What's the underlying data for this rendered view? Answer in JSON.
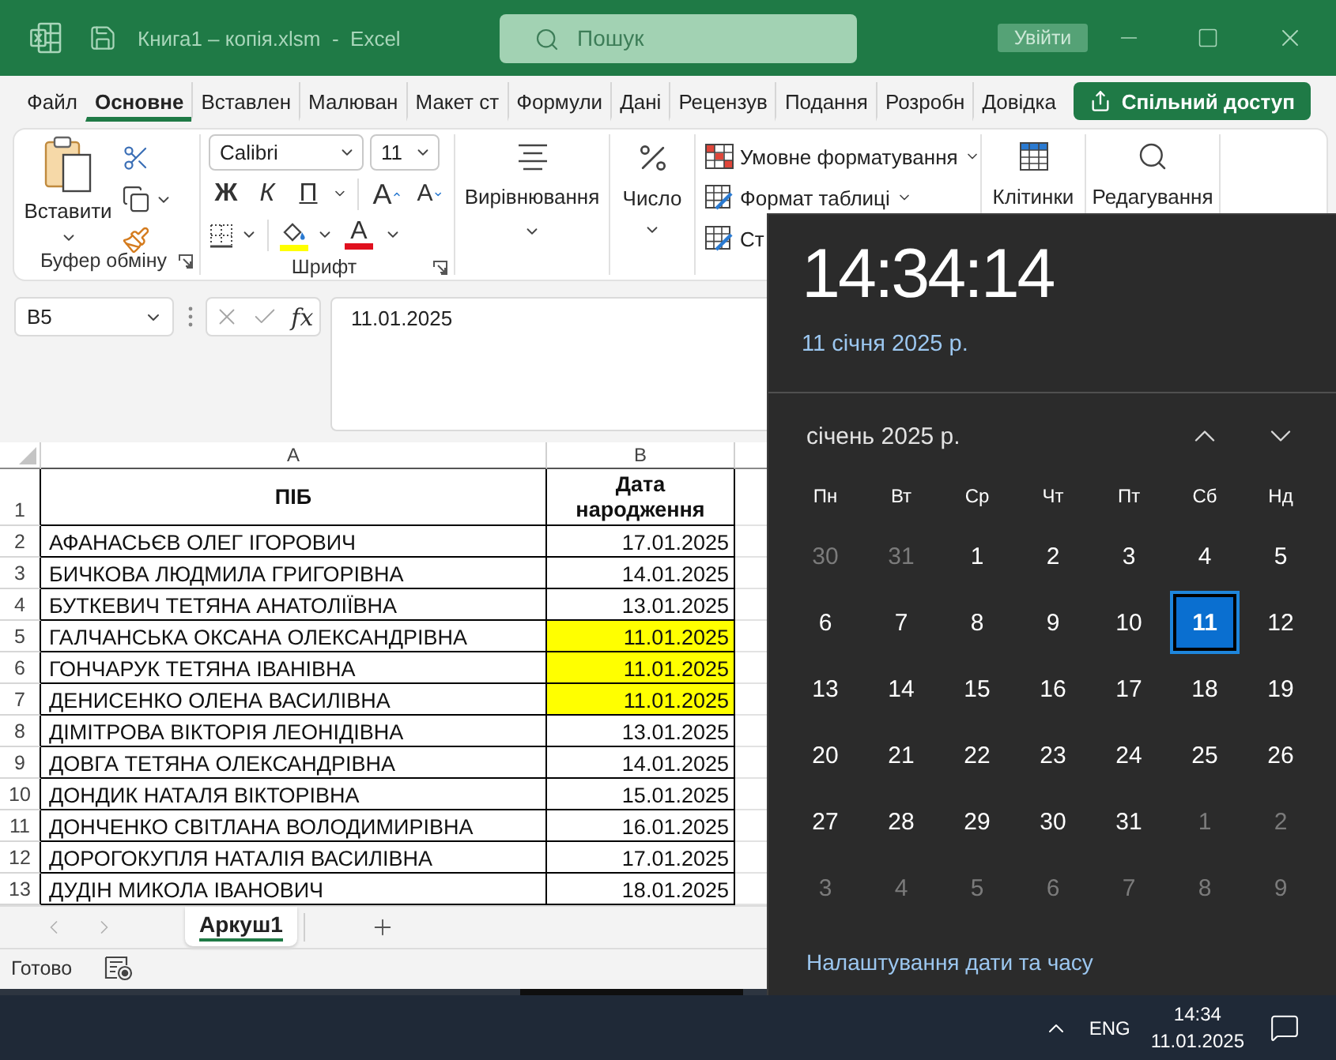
{
  "title_bar": {
    "document_title": "Книга1 – копія.xlsm  -  Excel",
    "search": {
      "placeholder": "Пошук"
    },
    "sign_in_button": "Увійти"
  },
  "ribbon_tabs": [
    {
      "label": "Файл",
      "selected": false
    },
    {
      "label": "Основне",
      "selected": true
    },
    {
      "label": "Вставлен",
      "selected": false
    },
    {
      "label": "Малюван",
      "selected": false
    },
    {
      "label": "Макет ст",
      "selected": false
    },
    {
      "label": "Формули",
      "selected": false
    },
    {
      "label": "Дані",
      "selected": false
    },
    {
      "label": "Рецензув",
      "selected": false
    },
    {
      "label": "Подання",
      "selected": false
    },
    {
      "label": "Розробн",
      "selected": false
    },
    {
      "label": "Довідка",
      "selected": false
    }
  ],
  "share_button": "Спільний доступ",
  "ribbon": {
    "clipboard": {
      "paste_button": "Вставити",
      "group_label": "Буфер обміну"
    },
    "font": {
      "font_name": "Calibri",
      "font_size": "11",
      "bold_button": "Ж",
      "italic_button": "К",
      "underline_button": "П",
      "grow_button": "A",
      "shrink_button": "A",
      "font_color_button": "A",
      "group_label": "Шрифт"
    },
    "alignment_button": "Вирівнювання",
    "number_button": "Число",
    "styles_buttons": [
      {
        "kind": "conditional",
        "label": "Умовне форматування",
        "dropdown": true
      },
      {
        "kind": "table",
        "label": "Формат таблиці",
        "dropdown": true
      },
      {
        "kind": "cell_styles",
        "label": "Ст"
      }
    ],
    "cells_button": "Клітинки",
    "editing_button": "Редагування"
  },
  "formula_bar": {
    "name_box": "B5",
    "function_button": "fx",
    "value": "11.01.2025"
  },
  "sheet": {
    "columns": [
      "A",
      "B"
    ],
    "header_row": {
      "number": "1",
      "name": "ПІБ",
      "date": "Дата народження"
    },
    "rows": [
      {
        "number": "2",
        "name": "АФАНАСЬЄВ ОЛЕГ ІГОРОВИЧ",
        "date": "17.01.2025",
        "highlighted": false
      },
      {
        "number": "3",
        "name": "БИЧКОВА ЛЮДМИЛА ГРИГОРІВНА",
        "date": "14.01.2025",
        "highlighted": false
      },
      {
        "number": "4",
        "name": "БУТКЕВИЧ ТЕТЯНА АНАТОЛІЇВНА",
        "date": "13.01.2025",
        "highlighted": false
      },
      {
        "number": "5",
        "name": "ГАЛЧАНСЬКА ОКСАНА ОЛЕКСАНДРІВНА",
        "date": "11.01.2025",
        "highlighted": true
      },
      {
        "number": "6",
        "name": "ГОНЧАРУК ТЕТЯНА ІВАНІВНА",
        "date": "11.01.2025",
        "highlighted": true
      },
      {
        "number": "7",
        "name": "ДЕНИСЕНКО ОЛЕНА ВАСИЛІВНА",
        "date": "11.01.2025",
        "highlighted": true
      },
      {
        "number": "8",
        "name": "ДІМІТРОВА ВІКТОРІЯ ЛЕОНІДІВНА",
        "date": "13.01.2025",
        "highlighted": false
      },
      {
        "number": "9",
        "name": "ДОВГА ТЕТЯНА ОЛЕКСАНДРІВНА",
        "date": "14.01.2025",
        "highlighted": false
      },
      {
        "number": "10",
        "name": "ДОНДИК НАТАЛЯ ВІКТОРІВНА",
        "date": "15.01.2025",
        "highlighted": false
      },
      {
        "number": "11",
        "name": "ДОНЧЕНКО СВІТЛАНА ВОЛОДИМИРІВНА",
        "date": "16.01.2025",
        "highlighted": false
      },
      {
        "number": "12",
        "name": "ДОРОГОКУПЛЯ НАТАЛІЯ ВАСИЛІВНА",
        "date": "17.01.2025",
        "highlighted": false
      },
      {
        "number": "13",
        "name": "ДУДІН МИКОЛА ІВАНОВИЧ",
        "date": "18.01.2025",
        "highlighted": false
      }
    ]
  },
  "sheet_tabs": [
    {
      "label": "Аркуш1",
      "selected": true
    }
  ],
  "status_bar": {
    "status": "Готово"
  },
  "taskbar": {
    "language": "ENG",
    "time": "14:34",
    "date": "11.01.2025"
  },
  "calendar": {
    "time": "14:34:14",
    "date": "11 січня 2025 р.",
    "month": "січень 2025 р.",
    "weekdays": [
      "Пн",
      "Вт",
      "Ср",
      "Чт",
      "Пт",
      "Сб",
      "Нд"
    ],
    "days": [
      {
        "label": "30",
        "in_month": false,
        "selected": false
      },
      {
        "label": "31",
        "in_month": false,
        "selected": false
      },
      {
        "label": "1",
        "in_month": true,
        "selected": false
      },
      {
        "label": "2",
        "in_month": true,
        "selected": false
      },
      {
        "label": "3",
        "in_month": true,
        "selected": false
      },
      {
        "label": "4",
        "in_month": true,
        "selected": false
      },
      {
        "label": "5",
        "in_month": true,
        "selected": false
      },
      {
        "label": "6",
        "in_month": true,
        "selected": false
      },
      {
        "label": "7",
        "in_month": true,
        "selected": false
      },
      {
        "label": "8",
        "in_month": true,
        "selected": false
      },
      {
        "label": "9",
        "in_month": true,
        "selected": false
      },
      {
        "label": "10",
        "in_month": true,
        "selected": false
      },
      {
        "label": "11",
        "in_month": true,
        "selected": true
      },
      {
        "label": "12",
        "in_month": true,
        "selected": false
      },
      {
        "label": "13",
        "in_month": true,
        "selected": false
      },
      {
        "label": "14",
        "in_month": true,
        "selected": false
      },
      {
        "label": "15",
        "in_month": true,
        "selected": false
      },
      {
        "label": "16",
        "in_month": true,
        "selected": false
      },
      {
        "label": "17",
        "in_month": true,
        "selected": false
      },
      {
        "label": "18",
        "in_month": true,
        "selected": false
      },
      {
        "label": "19",
        "in_month": true,
        "selected": false
      },
      {
        "label": "20",
        "in_month": true,
        "selected": false
      },
      {
        "label": "21",
        "in_month": true,
        "selected": false
      },
      {
        "label": "22",
        "in_month": true,
        "selected": false
      },
      {
        "label": "23",
        "in_month": true,
        "selected": false
      },
      {
        "label": "24",
        "in_month": true,
        "selected": false
      },
      {
        "label": "25",
        "in_month": true,
        "selected": false
      },
      {
        "label": "26",
        "in_month": true,
        "selected": false
      },
      {
        "label": "27",
        "in_month": true,
        "selected": false
      },
      {
        "label": "28",
        "in_month": true,
        "selected": false
      },
      {
        "label": "29",
        "in_month": true,
        "selected": false
      },
      {
        "label": "30",
        "in_month": true,
        "selected": false
      },
      {
        "label": "31",
        "in_month": true,
        "selected": false
      },
      {
        "label": "1",
        "in_month": false,
        "selected": false
      },
      {
        "label": "2",
        "in_month": false,
        "selected": false
      },
      {
        "label": "3",
        "in_month": false,
        "selected": false
      },
      {
        "label": "4",
        "in_month": false,
        "selected": false
      },
      {
        "label": "5",
        "in_month": false,
        "selected": false
      },
      {
        "label": "6",
        "in_month": false,
        "selected": false
      },
      {
        "label": "7",
        "in_month": false,
        "selected": false
      },
      {
        "label": "8",
        "in_month": false,
        "selected": false
      },
      {
        "label": "9",
        "in_month": false,
        "selected": false
      }
    ],
    "settings_link": "Налаштування дати та часу"
  }
}
